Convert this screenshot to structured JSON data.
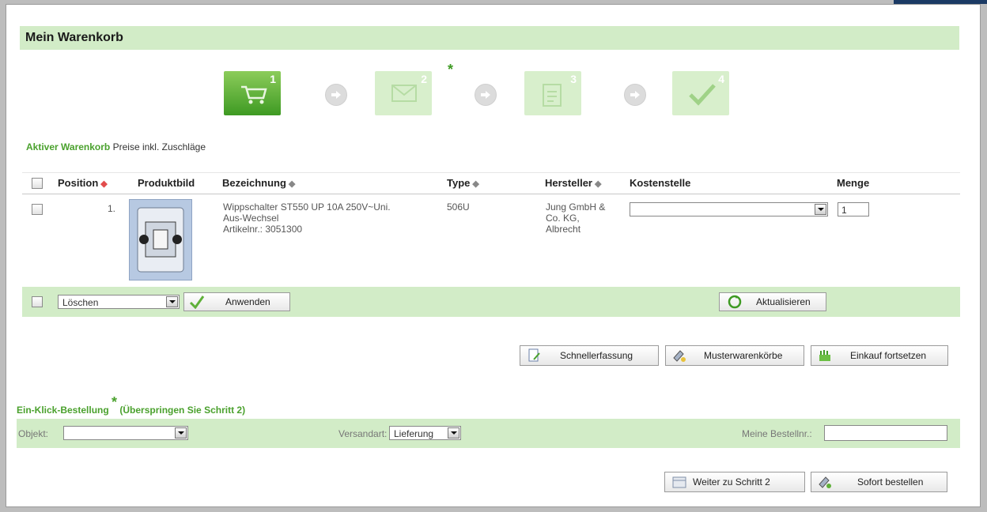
{
  "title": "Mein Warenkorb",
  "steps": [
    {
      "num": "1",
      "icon": "shopping-cart-icon",
      "active": true
    },
    {
      "num": "2",
      "icon": "envelope-icon",
      "active": false
    },
    {
      "num": "3",
      "icon": "clipboard-icon",
      "active": false
    },
    {
      "num": "4",
      "icon": "checkmark-icon",
      "active": false
    }
  ],
  "step_asterisk": "*",
  "cart_heading": {
    "bold": "Aktiver Warenkorb",
    "rest": " Preise inkl. Zuschläge"
  },
  "table": {
    "headers": {
      "position": "Position",
      "image": "Produktbild",
      "name": "Bezeichnung",
      "type": "Type",
      "maker": "Hersteller",
      "cost": "Kostenstelle",
      "qty": "Menge"
    },
    "sort_icon": "◆",
    "rows": [
      {
        "pos": "1.",
        "name_line1": "Wippschalter ST550 UP 10A 250V~Uni.",
        "name_line2": "Aus-Wechsel",
        "article": "Artikelnr.: 3051300",
        "type": "506U",
        "maker_line1": "Jung GmbH &",
        "maker_line2": "Co. KG,",
        "maker_line3": "Albrecht",
        "cost": "",
        "qty": "1"
      }
    ]
  },
  "actions": {
    "select_value": "Löschen",
    "apply": "Anwenden",
    "refresh": "Aktualisieren"
  },
  "buttons": {
    "quick": "Schnellerfassung",
    "templates": "Musterwarenkörbe",
    "continue": "Einkauf fortsetzen"
  },
  "oneclick": {
    "title": "Ein-Klick-Bestellung",
    "star": "*",
    "note": " (Überspringen Sie Schritt 2)"
  },
  "order": {
    "object_label": "Objekt:",
    "object_value": "",
    "shipping_label": "Versandart:",
    "shipping_value": "Lieferung",
    "ordernr_label": "Meine Bestellnr.:",
    "ordernr_value": ""
  },
  "footer": {
    "next": "Weiter zu Schritt 2",
    "order_now": "Sofort bestellen"
  },
  "colors": {
    "green_bar": "#d2ecc7",
    "green_text": "#4aa12d",
    "active_step": "#3e9a23"
  }
}
